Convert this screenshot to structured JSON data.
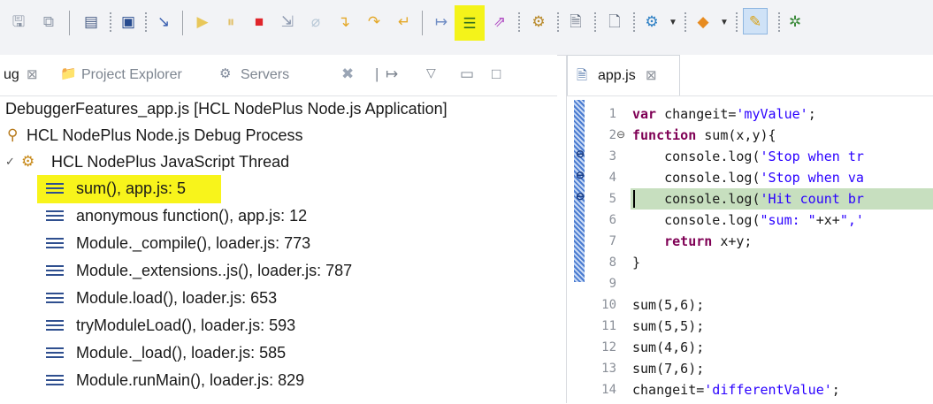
{
  "toolbar": {
    "icons": [
      "save-icon",
      "save-all-icon",
      "binary-icon",
      "console-icon",
      "clear-icon",
      "resume-icon",
      "suspend-icon",
      "terminate-icon",
      "disconnect-icon",
      "skip-breakpoints-icon",
      "step-into-icon",
      "step-over-icon",
      "step-return-icon",
      "drop-to-frame-icon",
      "show-stack-frames-icon",
      "use-step-filters-icon",
      "filter-icon",
      "open-file-icon",
      "new-file-icon",
      "run-icon",
      "package-icon",
      "highlight-icon"
    ]
  },
  "debug_view": {
    "tabs": [
      {
        "label": "ug",
        "close": "⊠"
      },
      {
        "label": "Project Explorer"
      },
      {
        "label": "Servers"
      }
    ],
    "tree": {
      "launch": "DebuggerFeatures_app.js [HCL NodePlus Node.js Application]",
      "process": "HCL NodePlus Node.js Debug Process",
      "thread": "HCL NodePlus JavaScript Thread",
      "frames": [
        "sum(), app.js: 5",
        "anonymous function(), app.js: 12",
        "Module._compile(), loader.js: 773",
        "Module._extensions..js(), loader.js: 787",
        "Module.load(), loader.js: 653",
        "tryModuleLoad(), loader.js: 593",
        "Module._load(), loader.js: 585",
        "Module.runMain(), loader.js: 829"
      ]
    }
  },
  "editor": {
    "tab_label": "app.js",
    "tab_close": "⊠",
    "lines": [
      {
        "n": "1",
        "segments": [
          {
            "t": "var",
            "k": "kw"
          },
          {
            "t": " changeit="
          },
          {
            "t": "'myValue'",
            "k": "str"
          },
          {
            "t": ";"
          }
        ]
      },
      {
        "n": "2",
        "segments": [
          {
            "t": "function",
            "k": "kw"
          },
          {
            "t": " sum(x,y){"
          }
        ]
      },
      {
        "n": "3",
        "segments": [
          {
            "t": "    console.log("
          },
          {
            "t": "'Stop when tr",
            "k": "str"
          }
        ]
      },
      {
        "n": "4",
        "segments": [
          {
            "t": "    console.log("
          },
          {
            "t": "'Stop when va",
            "k": "str"
          }
        ]
      },
      {
        "n": "5",
        "segments": [
          {
            "t": "    console.log("
          },
          {
            "t": "'Hit count br",
            "k": "str"
          }
        ]
      },
      {
        "n": "6",
        "segments": [
          {
            "t": "    console.log("
          },
          {
            "t": "\"sum: \"",
            "k": "str"
          },
          {
            "t": "+x+"
          },
          {
            "t": "\",'",
            "k": "str"
          }
        ]
      },
      {
        "n": "7",
        "segments": [
          {
            "t": "    "
          },
          {
            "t": "return",
            "k": "kw"
          },
          {
            "t": " x+y;"
          }
        ]
      },
      {
        "n": "8",
        "segments": [
          {
            "t": "}"
          }
        ]
      },
      {
        "n": "9",
        "segments": []
      },
      {
        "n": "10",
        "segments": [
          {
            "t": "sum(5,6);"
          }
        ]
      },
      {
        "n": "11",
        "segments": [
          {
            "t": "sum(5,5);"
          }
        ]
      },
      {
        "n": "12",
        "segments": [
          {
            "t": "sum(4,6);"
          }
        ]
      },
      {
        "n": "13",
        "segments": [
          {
            "t": "sum(7,6);"
          }
        ]
      },
      {
        "n": "14",
        "segments": [
          {
            "t": "changeit="
          },
          {
            "t": "'differentValue'",
            "k": "str"
          },
          {
            "t": ";"
          }
        ]
      }
    ]
  },
  "colors": {
    "highlight": "#f8f41b",
    "current_line": "#c7dfbf",
    "keyword": "#7f0055",
    "string": "#2a00ff"
  }
}
